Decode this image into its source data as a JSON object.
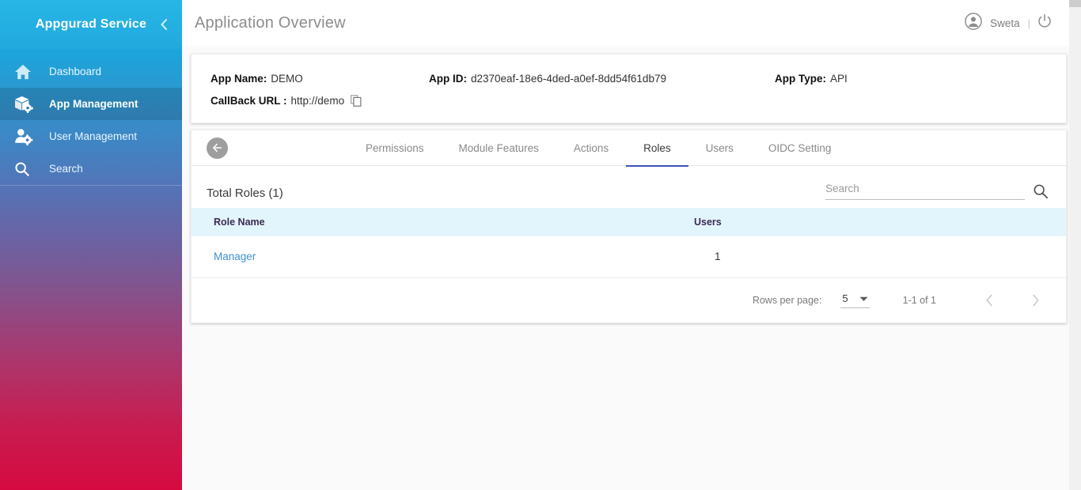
{
  "sidebar": {
    "brand": "Appgurad Service",
    "collapse_icon": "chevron-left-icon",
    "items": [
      {
        "label": "Dashboard",
        "icon": "home-icon",
        "active": false
      },
      {
        "label": "App Management",
        "icon": "box-gear-icon",
        "active": true
      },
      {
        "label": "User Management",
        "icon": "person-gear-icon",
        "active": false
      },
      {
        "label": "Search",
        "icon": "search-icon",
        "active": false
      }
    ]
  },
  "topbar": {
    "title": "Application Overview",
    "user_name": "Sweta",
    "separator": "|",
    "account_icon": "account-circle-icon",
    "power_icon": "power-off-icon"
  },
  "app_info": {
    "app_name_label": "App Name:",
    "app_name_value": "DEMO",
    "app_id_label": "App ID:",
    "app_id_value": "d2370eaf-18e6-4ded-a0ef-8dd54f61db79",
    "app_type_label": "App Type:",
    "app_type_value": "API",
    "callback_label": "CallBack URL :",
    "callback_value": "http://demo",
    "copy_icon": "copy-icon"
  },
  "tabs": {
    "back_icon": "arrow-left-icon",
    "items": [
      {
        "label": "Permissions",
        "active": false
      },
      {
        "label": "Module Features",
        "active": false
      },
      {
        "label": "Actions",
        "active": false
      },
      {
        "label": "Roles",
        "active": true
      },
      {
        "label": "Users",
        "active": false
      },
      {
        "label": "OIDC Setting",
        "active": false
      }
    ],
    "active_underline_color": "#3f51b5"
  },
  "roles_panel": {
    "heading": "Total Roles (1)",
    "search_placeholder": "Search",
    "search_value": "",
    "search_icon": "search-icon",
    "table": {
      "columns": [
        "Role Name",
        "Users"
      ],
      "rows": [
        {
          "role_name": "Manager",
          "users": "1"
        }
      ],
      "header_bg": "#e3f5fc",
      "header_text_color": "#3b2a55",
      "link_color": "#3f8fd0"
    },
    "paginator": {
      "rows_per_page_label": "Rows per page:",
      "rows_per_page_value": "5",
      "dropdown_icon": "caret-down-icon",
      "range_label": "1-1 of 1",
      "prev_icon": "chevron-left-icon",
      "next_icon": "chevron-right-icon"
    }
  }
}
